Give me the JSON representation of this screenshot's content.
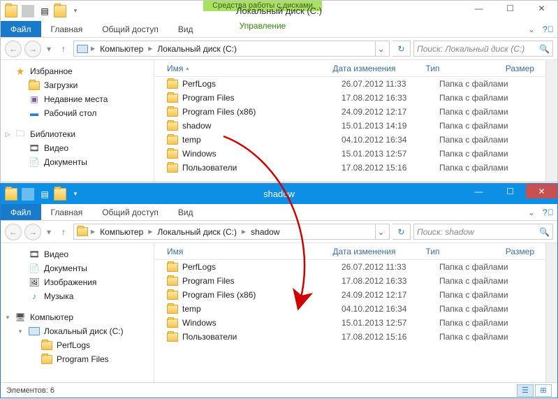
{
  "win1": {
    "context_tab": "Средства работы с дисками",
    "title": "Локальный диск (C:)",
    "tabs": {
      "file": "Файл",
      "home": "Главная",
      "share": "Общий доступ",
      "view": "Вид",
      "manage": "Управление"
    },
    "breadcrumb": [
      "Компьютер",
      "Локальный диск (C:)"
    ],
    "search_placeholder": "Поиск: Локальный диск (C:)",
    "sidebar": {
      "fav_head": "Избранное",
      "fav": [
        "Загрузки",
        "Недавние места",
        "Рабочий стол"
      ],
      "lib_head": "Библиотеки",
      "lib": [
        "Видео",
        "Документы"
      ]
    },
    "cols": {
      "name": "Имя",
      "date": "Дата изменения",
      "type": "Тип",
      "size": "Размер"
    },
    "rows": [
      {
        "name": "PerfLogs",
        "date": "26.07.2012 11:33",
        "type": "Папка с файлами"
      },
      {
        "name": "Program Files",
        "date": "17.08.2012 16:33",
        "type": "Папка с файлами"
      },
      {
        "name": "Program Files (x86)",
        "date": "24.09.2012 12:17",
        "type": "Папка с файлами"
      },
      {
        "name": "shadow",
        "date": "15.01.2013 14:19",
        "type": "Папка с файлами"
      },
      {
        "name": "temp",
        "date": "04.10.2012 16:34",
        "type": "Папка с файлами"
      },
      {
        "name": "Windows",
        "date": "15.01.2013 12:57",
        "type": "Папка с файлами"
      },
      {
        "name": "Пользователи",
        "date": "17.08.2012 15:16",
        "type": "Папка с файлами"
      }
    ]
  },
  "win2": {
    "title": "shadow",
    "tabs": {
      "file": "Файл",
      "home": "Главная",
      "share": "Общий доступ",
      "view": "Вид"
    },
    "breadcrumb": [
      "Компьютер",
      "Локальный диск (C:)",
      "shadow"
    ],
    "search_placeholder": "Поиск: shadow",
    "sidebar": {
      "lib": [
        "Видео",
        "Документы",
        "Изображения",
        "Музыка"
      ],
      "pc_head": "Компьютер",
      "drive": "Локальный диск (C:)",
      "children": [
        "PerfLogs",
        "Program Files"
      ]
    },
    "cols": {
      "name": "Имя",
      "date": "Дата изменения",
      "type": "Тип",
      "size": "Размер"
    },
    "rows": [
      {
        "name": "PerfLogs",
        "date": "26.07.2012 11:33",
        "type": "Папка с файлами"
      },
      {
        "name": "Program Files",
        "date": "17.08.2012 16:33",
        "type": "Папка с файлами"
      },
      {
        "name": "Program Files (x86)",
        "date": "24.09.2012 12:17",
        "type": "Папка с файлами"
      },
      {
        "name": "temp",
        "date": "04.10.2012 16:34",
        "type": "Папка с файлами"
      },
      {
        "name": "Windows",
        "date": "15.01.2013 12:57",
        "type": "Папка с файлами"
      },
      {
        "name": "Пользователи",
        "date": "17.08.2012 15:16",
        "type": "Папка с файлами"
      }
    ],
    "status": "Элементов: 6"
  }
}
